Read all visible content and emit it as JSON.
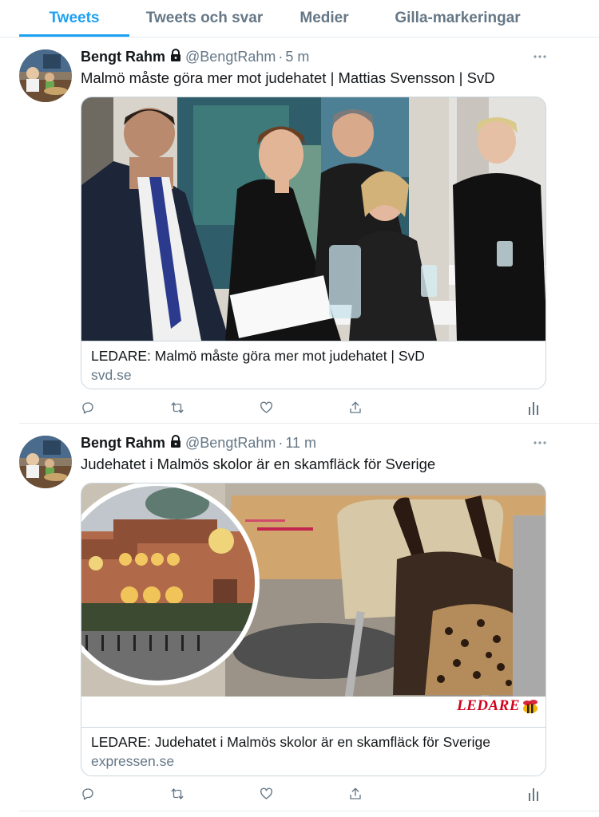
{
  "tabs": [
    {
      "label": "Tweets",
      "active": true
    },
    {
      "label": "Tweets och svar",
      "active": false
    },
    {
      "label": "Medier",
      "active": false
    },
    {
      "label": "Gilla-markeringar",
      "active": false
    }
  ],
  "tweets": [
    {
      "name": "Bengt Rahm",
      "handle": "@BengtRahm",
      "dot": "·",
      "time": "5 m",
      "text": "Malmö måste göra mer mot judehatet | Mattias Svensson | SvD",
      "card": {
        "title": "LEDARE: Malmö måste göra mer mot judehatet | SvD",
        "domain": "svd.se"
      }
    },
    {
      "name": "Bengt Rahm",
      "handle": "@BengtRahm",
      "dot": "·",
      "time": "11 m",
      "text": "Judehatet i Malmös skolor är en skamfläck för Sverige",
      "card": {
        "badge": "LEDARE",
        "title": "LEDARE: Judehatet i Malmös skolor är en skamfläck för Sverige",
        "domain": "expressen.se"
      }
    }
  ],
  "icons": {
    "lock": "lock-icon",
    "more": "more-icon",
    "reply": "reply-icon",
    "retweet": "retweet-icon",
    "like": "heart-icon",
    "share": "share-icon",
    "analytics": "analytics-icon"
  },
  "colors": {
    "accent": "#1da1f2",
    "secondary_text": "#657786",
    "border": "#ccd6dd",
    "ledare_red": "#d0021b"
  }
}
